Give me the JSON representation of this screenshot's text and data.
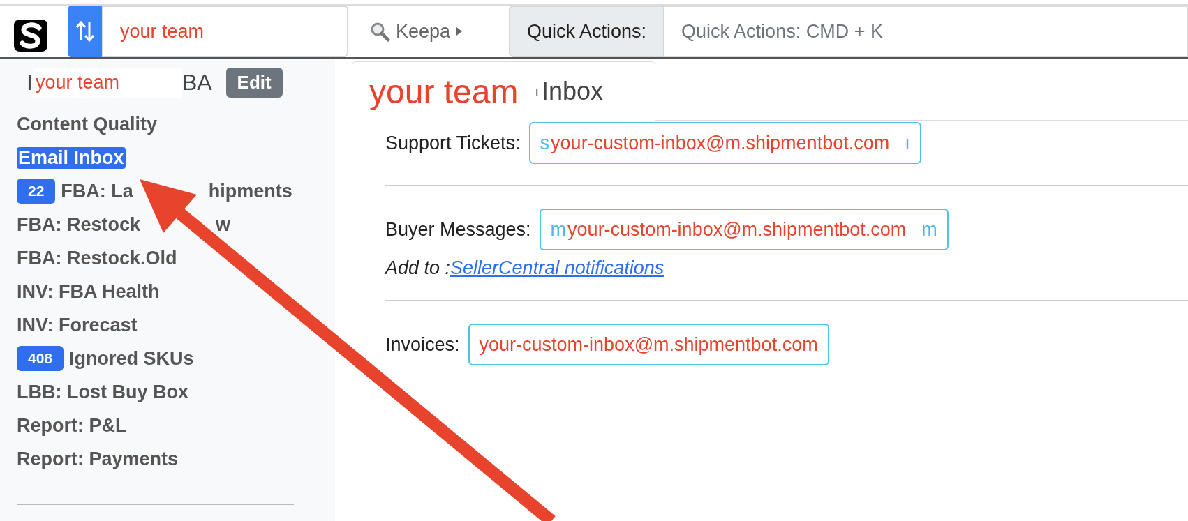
{
  "top_bar": {
    "team_field": {
      "value": "your team"
    },
    "keepa": {
      "label": "Keepa"
    },
    "quick_actions": {
      "addon": "Quick Actions:",
      "placeholder": "Quick Actions: CMD + K"
    }
  },
  "sidebar": {
    "title": {
      "left": "I",
      "overlay": "your team",
      "right": "BA"
    },
    "edit_button": "Edit",
    "items": [
      {
        "label": "Content Quality",
        "selected": false
      },
      {
        "label": "Email Inbox",
        "selected": true
      },
      {
        "label": "FBA: La",
        "rest": "hipments",
        "badge": "22",
        "selected": false
      },
      {
        "label": "FBA: Restock",
        "rest": "w",
        "selected": false
      },
      {
        "label": "FBA: Restock.Old",
        "selected": false
      },
      {
        "label": "INV: FBA Health",
        "selected": false
      },
      {
        "label": "INV: Forecast",
        "selected": false
      },
      {
        "label": "Ignored SKUs",
        "badge": "408",
        "selected": false
      },
      {
        "label": "LBB: Lost Buy Box",
        "selected": false
      },
      {
        "label": "Report: P&L",
        "selected": false
      },
      {
        "label": "Report: Payments",
        "selected": false
      }
    ]
  },
  "tab": {
    "overlay": "your team",
    "fragment": "ı",
    "label": "Inbox"
  },
  "rows": [
    {
      "label": "Support Tickets:",
      "peek_start": "s",
      "value": "your-custom-inbox@m.shipmentbot.com",
      "peek_end": "ı"
    },
    {
      "label": "Buyer Messages:",
      "peek_start": "m",
      "value": "your-custom-inbox@m.shipmentbot.com",
      "peek_end": "m",
      "note": "Add to :",
      "link": "SellerCentral notifications"
    },
    {
      "label": "Invoices:",
      "value": "your-custom-inbox@m.shipmentbot.com"
    }
  ]
}
